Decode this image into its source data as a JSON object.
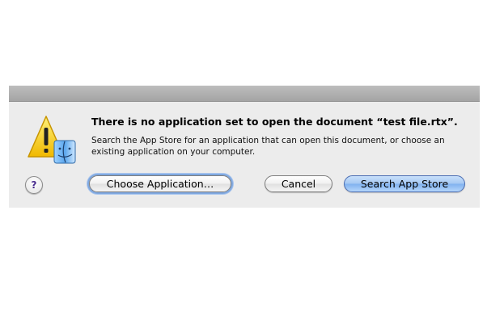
{
  "dialog": {
    "title": "There is no application set to open the document “test file.rtx”.",
    "message": "Search the App Store for an application that can open this document, or choose an existing application on your computer.",
    "icon": "warning-finder-icon",
    "help_label": "?",
    "buttons": {
      "choose_label": "Choose Application…",
      "cancel_label": "Cancel",
      "search_label": "Search App Store"
    }
  },
  "colors": {
    "sheet_background": "#ececec",
    "default_button": "#a4c7f2",
    "warning_yellow": "#f5c800"
  }
}
